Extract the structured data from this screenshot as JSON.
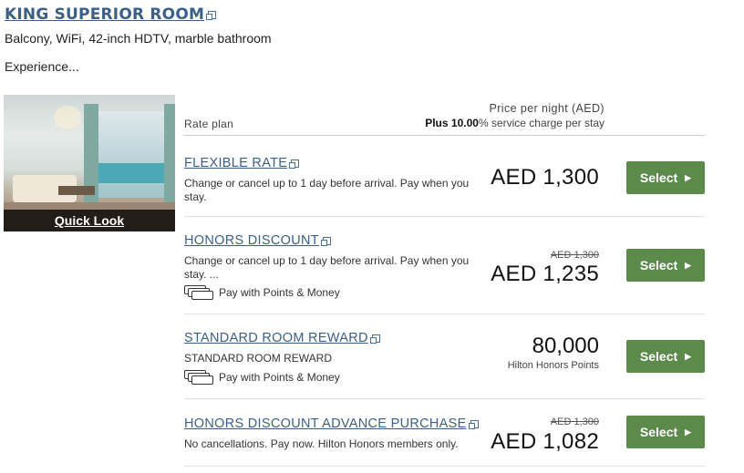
{
  "room": {
    "title": "KING SUPERIOR ROOM",
    "description": "Balcony, WiFi, 42-inch HDTV, marble bathroom",
    "experience": "Experience...",
    "quick_look": "Quick Look"
  },
  "table_header": {
    "rate_plan": "Rate plan",
    "price_per_night": "Price per night (AED)",
    "plus_label": "Plus 10.00",
    "service_charge": "% service charge per stay"
  },
  "rates": [
    {
      "name": "FLEXIBLE RATE",
      "description": "Change or cancel up to 1 day before arrival. Pay when you stay.",
      "price": "AED 1,300",
      "select": "Select"
    },
    {
      "name": "HONORS DISCOUNT",
      "description": "Change or cancel up to 1 day before arrival. Pay when you stay. ...",
      "points_money": "Pay with Points & Money",
      "original_price": "AED 1,300",
      "price": "AED 1,235",
      "select": "Select"
    },
    {
      "name": "STANDARD ROOM REWARD",
      "description": "STANDARD ROOM REWARD",
      "points_money": "Pay with Points & Money",
      "points": "80,000",
      "points_label": "Hilton Honors Points",
      "select": "Select"
    },
    {
      "name": "HONORS DISCOUNT ADVANCE PURCHASE",
      "description": "No cancellations. Pay now. Hilton Honors members only.",
      "original_price": "AED 1,300",
      "price": "AED 1,082",
      "select": "Select"
    }
  ],
  "colors": {
    "link": "#3b5f86",
    "select_button": "#5b8a4b"
  },
  "icons": [
    "external-link-icon",
    "points-money-icon",
    "caret-right-icon"
  ]
}
